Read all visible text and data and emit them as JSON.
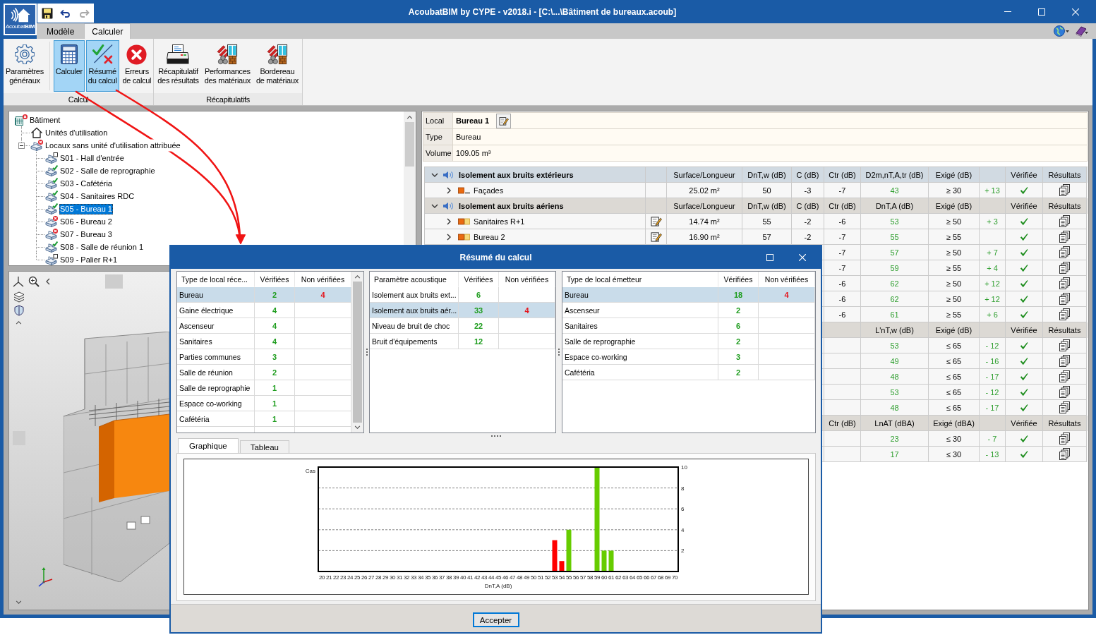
{
  "window": {
    "title": "AcoubatBIM by CYPE - v2018.i - [C:\\...\\Bâtiment de bureaux.acoub]",
    "logo": "Acoubat**BIM**"
  },
  "quick_access": [
    {
      "kind": "save",
      "disabled": false
    },
    {
      "kind": "undo",
      "disabled": false
    },
    {
      "kind": "redo",
      "disabled": true
    }
  ],
  "ribbon_tabs": [
    {
      "label": "Modèle",
      "selected": false
    },
    {
      "label": "Calculer",
      "selected": true
    }
  ],
  "ribbon_groups": [
    {
      "label": "Calcul",
      "buttons": [
        {
          "label": "Paramètres\ngénéraux",
          "kind": "gear",
          "selected": false
        },
        {
          "label": "Calculer",
          "kind": "calculator",
          "selected": true
        },
        {
          "label": "Résumé\ndu calcul",
          "kind": "summary",
          "selected": true
        },
        {
          "label": "Erreurs\nde calcul",
          "kind": "errors",
          "selected": false
        }
      ]
    },
    {
      "label": "Récapitulatifs",
      "buttons": [
        {
          "label": "Récapitulatif\ndes résultats",
          "kind": "report",
          "selected": false
        },
        {
          "label": "Performances\ndes matériaux",
          "kind": "materials",
          "selected": false
        },
        {
          "label": "Bordereau\nde matériaux",
          "kind": "materials",
          "selected": false
        }
      ]
    }
  ],
  "tree": [
    {
      "label": "Bâtiment",
      "kind": "building",
      "calculated": true,
      "verified": false,
      "selected": false,
      "children": [
        {
          "label": "Unités d'utilisation",
          "kind": "house",
          "selected": false
        },
        {
          "label": "Locaux sans unité d'utilisation attribuée",
          "kind": "room",
          "calculated": true,
          "verified": false,
          "expanded": true,
          "selected": false,
          "children": [
            {
              "label": "S01 - Hall d'entrée",
              "kind": "room",
              "calculated": false,
              "selected": false
            },
            {
              "label": "S02 - Salle de reprographie",
              "kind": "room",
              "calculated": true,
              "verified": true,
              "selected": false
            },
            {
              "label": "S03 - Cafétéria",
              "kind": "room",
              "calculated": true,
              "verified": true,
              "selected": false
            },
            {
              "label": "S04 - Sanitaires RDC",
              "kind": "room",
              "calculated": true,
              "verified": true,
              "selected": false
            },
            {
              "label": "S05 - Bureau 1",
              "kind": "room",
              "calculated": true,
              "verified": true,
              "selected": true
            },
            {
              "label": "S06 - Bureau 2",
              "kind": "room",
              "calculated": true,
              "verified": false,
              "selected": false
            },
            {
              "label": "S07 - Bureau 3",
              "kind": "room",
              "calculated": true,
              "verified": false,
              "selected": false
            },
            {
              "label": "S08 - Salle de réunion 1",
              "kind": "room",
              "calculated": true,
              "verified": true,
              "selected": false
            },
            {
              "label": "S09 - Palier R+1",
              "kind": "room",
              "calculated": false,
              "selected": false
            }
          ]
        }
      ]
    }
  ],
  "room_info": [
    {
      "label": "Local",
      "value": "Bureau 1",
      "editable": true
    },
    {
      "label": "Type",
      "value": "Bureau"
    },
    {
      "label": "Volume",
      "value": "109.05 m³"
    }
  ],
  "results_table": [
    {
      "title": "Isolement aux bruits extérieurs",
      "expanded": true,
      "selected": true,
      "header": {
        "surface": "Surface/Longueur",
        "dntw": "DnT,w (dB)",
        "c": "C (dB)",
        "ctr": "Ctr (dB)",
        "result": "D2m,nT,A,tr (dB)",
        "required": "Exigé (dB)",
        "verified": "Vérifiée",
        "results": "Résultats"
      },
      "rows": [
        {
          "name": "Façades",
          "kind": "facade",
          "expanded": false,
          "surface": "25.02 m²",
          "dntw": "50",
          "c": "-3",
          "ctr": "-7",
          "result": "43",
          "required": "≥ 30",
          "column_9": "+ 13",
          "verified": true
        }
      ]
    },
    {
      "title": "Isolement aux bruits aériens",
      "expanded": true,
      "selected": false,
      "header": {
        "surface": "Surface/Longueur",
        "dntw": "DnT,w (dB)",
        "c": "C (dB)",
        "ctr": "Ctr (dB)",
        "result": "DnT,A (dB)",
        "required": "Exigé (dB)",
        "verified": "Vérifiée",
        "results": "Résultats"
      },
      "rows": [
        {
          "name": "Sanitaires R+1",
          "kind": "wall",
          "expanded": false,
          "editable": true,
          "surface": "14.74 m²",
          "dntw": "55",
          "c": "-2",
          "ctr": "-6",
          "result": "53",
          "required": "≥ 50",
          "column_9": "+ 3",
          "verified": true
        },
        {
          "name": "Bureau 2",
          "kind": "wall",
          "expanded": false,
          "editable": true,
          "surface": "16.90 m²",
          "dntw": "57",
          "c": "-2",
          "ctr": "-7",
          "result": "55",
          "required": "≥ 55",
          "verified": true
        },
        {
          "ctr": "-7",
          "result": "57",
          "required": "≥ 50",
          "column_9": "+ 7",
          "verified": true
        },
        {
          "ctr": "-7",
          "result": "59",
          "required": "≥ 55",
          "column_9": "+ 4",
          "verified": true
        },
        {
          "ctr": "-6",
          "result": "62",
          "required": "≥ 50",
          "column_9": "+ 12",
          "verified": true
        },
        {
          "ctr": "-6",
          "result": "62",
          "required": "≥ 50",
          "column_9": "+ 12",
          "verified": true
        },
        {
          "ctr": "-6",
          "result": "61",
          "required": "≥ 55",
          "column_9": "+ 6",
          "verified": true
        }
      ]
    },
    {
      "selected": false,
      "header": {
        "result": "L'nT,w (dB)",
        "required": "Exigé (dB)",
        "verified": "Vérifiée",
        "results": "Résultats"
      },
      "rows": [
        {
          "result": "53",
          "required": "≤ 65",
          "column_9": "- 12",
          "verified": true
        },
        {
          "result": "49",
          "required": "≤ 65",
          "column_9": "- 16",
          "verified": true
        },
        {
          "result": "48",
          "required": "≤ 65",
          "column_9": "- 17",
          "verified": true
        },
        {
          "result": "53",
          "required": "≤ 65",
          "column_9": "- 12",
          "verified": true
        },
        {
          "result": "48",
          "required": "≤ 65",
          "column_9": "- 17",
          "verified": true
        }
      ]
    },
    {
      "selected": false,
      "header": {
        "ctr": "Ctr (dB)",
        "result": "LnAT (dBA)",
        "required": "Exigé (dBA)",
        "verified": "Vérifiée",
        "results": "Résultats"
      },
      "rows": [
        {
          "result": "23",
          "required": "≤ 30",
          "column_9": "- 7",
          "verified": true
        },
        {
          "result": "17",
          "required": "≤ 30",
          "column_9": "- 13",
          "verified": true
        }
      ]
    }
  ],
  "summary_dialog": {
    "title": "Résumé du calcul",
    "lists": [
      {
        "columns": [
          "Type de local réce...",
          "Vérifiées",
          "Non vérifiées"
        ],
        "rows": [
          {
            "label": "Bureau",
            "verified": "2",
            "not_verified": "4",
            "selected": true
          },
          {
            "label": "Gaine électrique",
            "verified": "4",
            "selected": false
          },
          {
            "label": "Ascenseur",
            "verified": "4",
            "selected": false
          },
          {
            "label": "Sanitaires",
            "verified": "4",
            "selected": false
          },
          {
            "label": "Parties communes",
            "verified": "3",
            "selected": false
          },
          {
            "label": "Salle de réunion",
            "verified": "2",
            "selected": false
          },
          {
            "label": "Salle de reprographie",
            "verified": "1",
            "selected": false
          },
          {
            "label": "Espace co-working",
            "verified": "1",
            "selected": false
          },
          {
            "label": "Cafétéria",
            "verified": "1",
            "selected": false
          }
        ]
      },
      {
        "columns": [
          "Paramètre acoustique",
          "Vérifiées",
          "Non vérifiées"
        ],
        "rows": [
          {
            "label": "Isolement aux bruits ext...",
            "verified": "6",
            "selected": false
          },
          {
            "label": "Isolement aux bruits aér...",
            "verified": "33",
            "not_verified": "4",
            "selected": true
          },
          {
            "label": "Niveau de bruit de choc",
            "verified": "22",
            "selected": false
          },
          {
            "label": "Bruit d'équipements",
            "verified": "12",
            "selected": false
          }
        ]
      },
      {
        "columns": [
          "Type de local émetteur",
          "Vérifiées",
          "Non vérifiées"
        ],
        "rows": [
          {
            "label": "Bureau",
            "verified": "18",
            "not_verified": "4",
            "selected": true
          },
          {
            "label": "Ascenseur",
            "verified": "2",
            "selected": false
          },
          {
            "label": "Sanitaires",
            "verified": "6",
            "selected": false
          },
          {
            "label": "Salle de reprographie",
            "verified": "2",
            "selected": false
          },
          {
            "label": "Espace co-working",
            "verified": "3",
            "selected": false
          },
          {
            "label": "Cafétéria",
            "verified": "2",
            "selected": false
          }
        ]
      }
    ],
    "tabs": [
      {
        "label": "Graphique",
        "selected": true
      },
      {
        "label": "Tableau",
        "selected": false
      }
    ],
    "chart_data": {
      "type": "bar",
      "xlabel": "DnT,A (dB)",
      "ylabel": "Cas",
      "categories": [
        "20",
        "21",
        "22",
        "23",
        "24",
        "25",
        "26",
        "27",
        "28",
        "29",
        "30",
        "31",
        "32",
        "33",
        "34",
        "35",
        "36",
        "37",
        "38",
        "39",
        "40",
        "41",
        "42",
        "43",
        "44",
        "45",
        "46",
        "47",
        "48",
        "49",
        "50",
        "51",
        "52",
        "53",
        "54",
        "55",
        "56",
        "57",
        "58",
        "59",
        "60",
        "61",
        "62",
        "63",
        "64",
        "65",
        "66",
        "67",
        "68",
        "69",
        "70"
      ],
      "series": [
        {
          "color": "#ff0000",
          "values": [
            0,
            0,
            0,
            0,
            0,
            0,
            0,
            0,
            0,
            0,
            0,
            0,
            0,
            0,
            0,
            0,
            0,
            0,
            0,
            0,
            0,
            0,
            0,
            0,
            0,
            0,
            0,
            0,
            0,
            0,
            0,
            0,
            0,
            3,
            1,
            0,
            0,
            0,
            0,
            0,
            0,
            0,
            0,
            0,
            0,
            0,
            0,
            0,
            0,
            0,
            0
          ]
        },
        {
          "color": "#66cc00",
          "values": [
            0,
            0,
            0,
            0,
            0,
            0,
            0,
            0,
            0,
            0,
            0,
            0,
            0,
            0,
            0,
            0,
            0,
            0,
            0,
            0,
            0,
            0,
            0,
            0,
            0,
            0,
            0,
            0,
            0,
            0,
            0,
            0,
            0,
            0,
            0,
            4,
            0,
            0,
            0,
            10,
            2,
            2,
            0,
            0,
            0,
            0,
            0,
            0,
            0,
            0,
            0
          ]
        }
      ],
      "ylim": [
        0,
        10
      ],
      "yticks": [
        2,
        4,
        6,
        8,
        10
      ],
      "grid": true
    },
    "buttons": [
      {
        "label": "Accepter"
      }
    ]
  }
}
